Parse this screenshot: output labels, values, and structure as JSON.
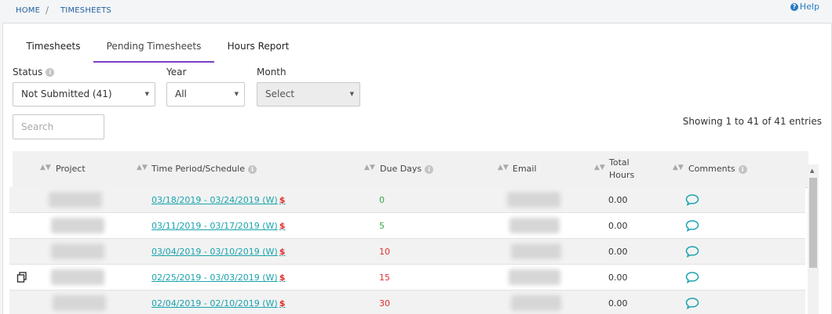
{
  "breadcrumb": {
    "home": "HOME",
    "sep": "/",
    "current": "TIMESHEETS"
  },
  "help": {
    "icon": "?",
    "label": "Help"
  },
  "tabs": [
    {
      "label": "Timesheets"
    },
    {
      "label": "Pending Timesheets",
      "active": true
    },
    {
      "label": "Hours Report"
    }
  ],
  "filters": {
    "status": {
      "label": "Status",
      "value": "Not Submitted (41)"
    },
    "year": {
      "label": "Year",
      "value": "All"
    },
    "month": {
      "label": "Month",
      "value": "Select"
    }
  },
  "search": {
    "placeholder": "Search"
  },
  "showing": "Showing 1 to 41 of 41 entries",
  "columns": {
    "project": "Project",
    "period": "Time Period/Schedule",
    "due": "Due Days",
    "email": "Email",
    "total_hours": "Total Hours",
    "comments": "Comments"
  },
  "rows": [
    {
      "period": "03/18/2019 - 03/24/2019 (W)",
      "due": "0",
      "due_color": "green",
      "hours": "0.00"
    },
    {
      "period": "03/11/2019 - 03/17/2019 (W)",
      "due": "5",
      "due_color": "green",
      "hours": "0.00"
    },
    {
      "period": "03/04/2019 - 03/10/2019 (W)",
      "due": "10",
      "due_color": "red",
      "hours": "0.00"
    },
    {
      "period": "02/25/2019 - 03/03/2019 (W)",
      "due": "15",
      "due_color": "red",
      "hours": "0.00"
    },
    {
      "period": "02/04/2019 - 02/10/2019 (W)",
      "due": "30",
      "due_color": "red",
      "hours": "0.00"
    }
  ],
  "dollar": "$",
  "colors": {
    "accent": "#7b3fc4",
    "link": "#19a3ad",
    "due_green": "#3aa847",
    "due_red": "#e0302e"
  }
}
